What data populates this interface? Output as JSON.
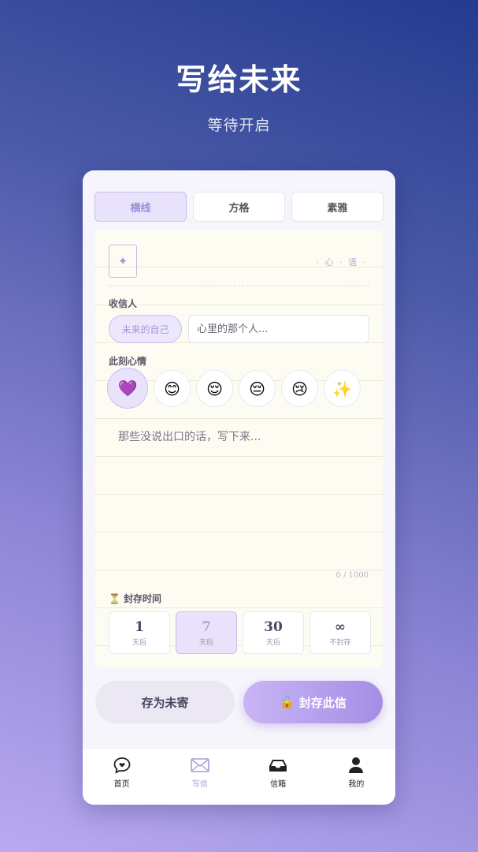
{
  "header": {
    "title": "写给未来",
    "subtitle": "等待开启"
  },
  "style_tabs": [
    {
      "label": "横线",
      "active": true
    },
    {
      "label": "方格",
      "active": false
    },
    {
      "label": "素雅",
      "active": false
    }
  ],
  "paper": {
    "stamp_icon": "sparkle-icon",
    "stamp_glyph": "✦",
    "seal_text": "· 心 · 语 ·"
  },
  "recipient": {
    "label": "收信人",
    "chip": "未来的自己",
    "placeholder": "心里的那个人..."
  },
  "mood": {
    "label": "此刻心情",
    "options": [
      "💜",
      "😊",
      "😌",
      "😔",
      "😢",
      "✨"
    ],
    "selected_index": 0
  },
  "letter": {
    "placeholder": "那些没说出口的话，写下来...",
    "counter": "0 / 1000"
  },
  "seal_time": {
    "icon": "⏳",
    "label": "封存时间",
    "options": [
      {
        "num": "1",
        "unit": "天后",
        "active": false
      },
      {
        "num": "7",
        "unit": "天后",
        "active": true
      },
      {
        "num": "30",
        "unit": "天后",
        "active": false
      },
      {
        "num": "∞",
        "unit": "不封存",
        "active": false
      }
    ]
  },
  "actions": {
    "draft_label": "存为未寄",
    "seal_label": "封存此信",
    "seal_icon": "🔓"
  },
  "tabbar": [
    {
      "label": "首页",
      "icon": "chat-heart-icon",
      "active": false
    },
    {
      "label": "写信",
      "icon": "mail-icon",
      "active": true
    },
    {
      "label": "信箱",
      "icon": "inbox-icon",
      "active": false
    },
    {
      "label": "我的",
      "icon": "user-icon",
      "active": false
    }
  ],
  "colors": {
    "accent": "#a99bd9",
    "accent_bg": "#e8e2fb",
    "paper": "#fdfcf3"
  }
}
